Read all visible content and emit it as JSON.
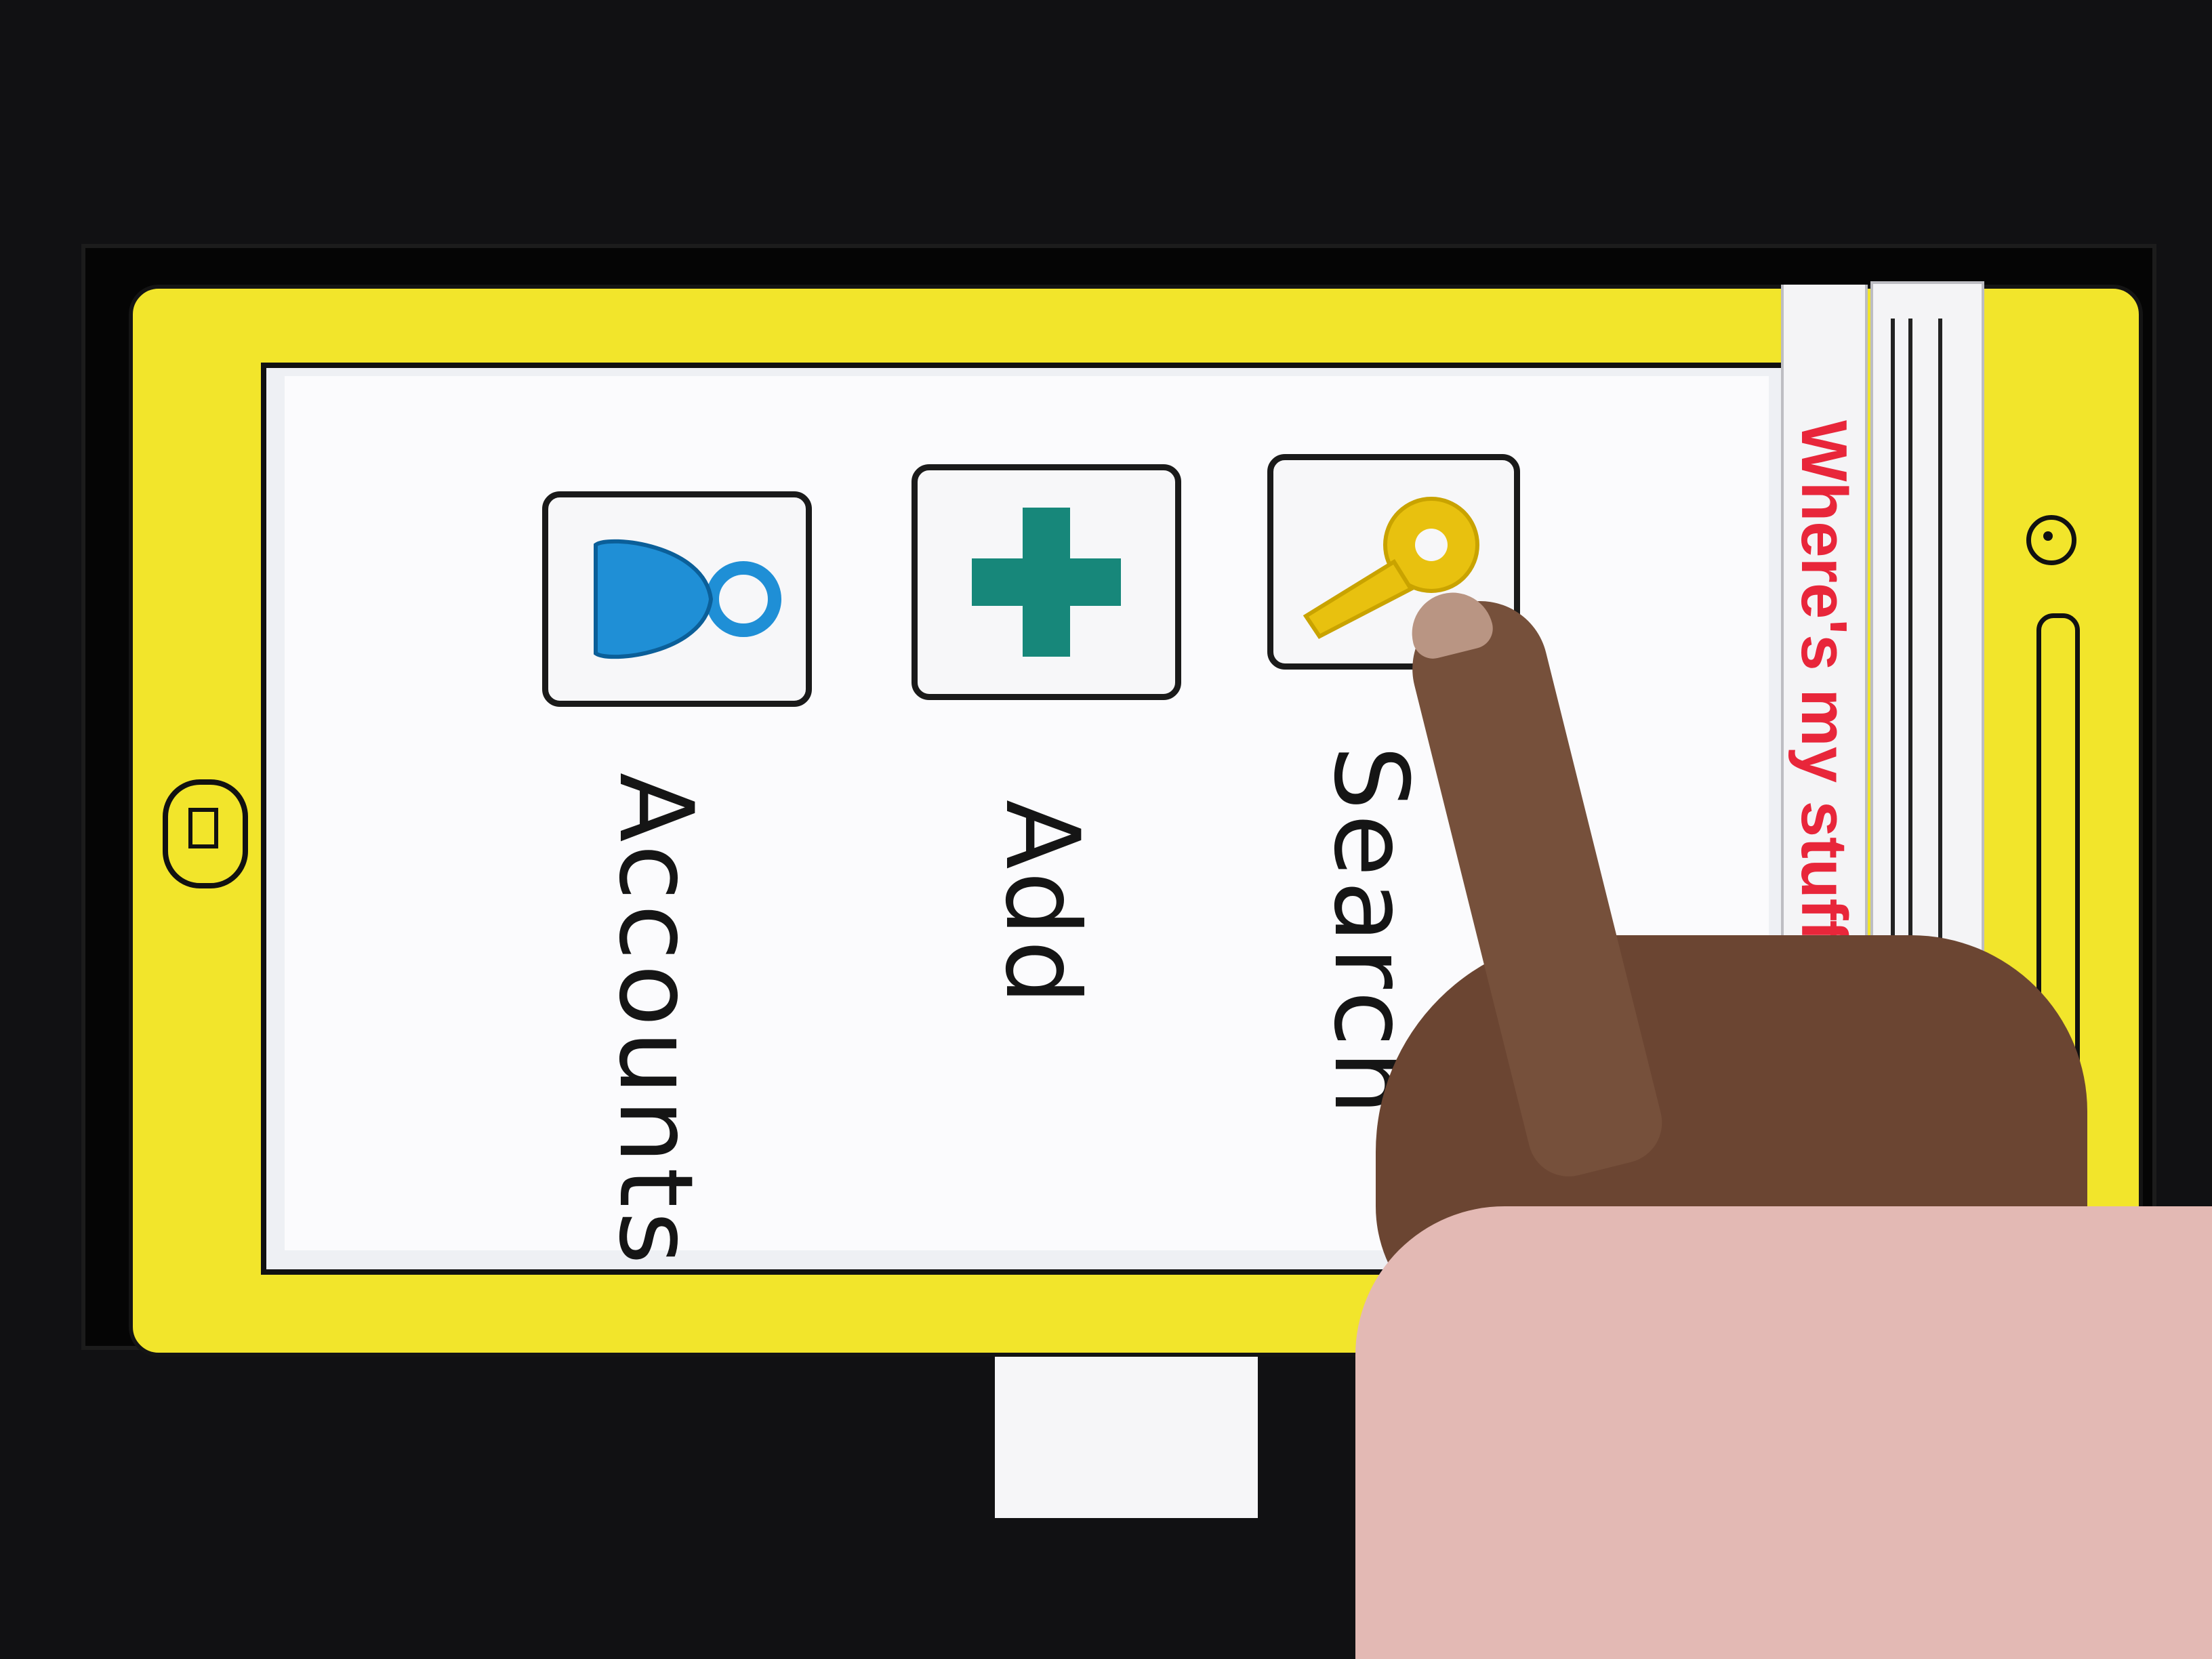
{
  "app": {
    "title": "Where's my stuff"
  },
  "home_screen": {
    "apps": [
      {
        "label": "Accounts",
        "icon": "person-icon",
        "icon_color": "#1f8fd6"
      },
      {
        "label": "Add",
        "icon": "plus-icon",
        "icon_color": "#17877a"
      },
      {
        "label": "Search",
        "icon": "key-icon",
        "icon_color": "#e8c10f"
      }
    ]
  },
  "colors": {
    "phone_body": "#f2e52b",
    "title_text": "#e8263a"
  }
}
